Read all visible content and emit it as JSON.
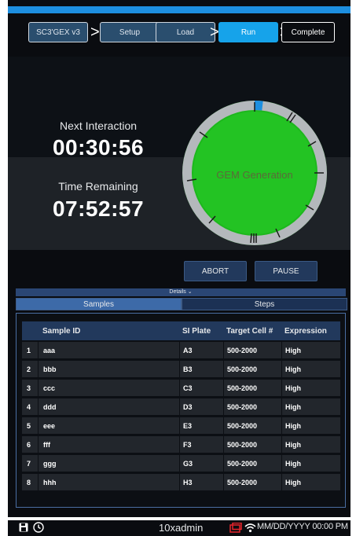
{
  "stepper": {
    "steps": [
      {
        "label": "SC3'GEX v3",
        "state": "done"
      },
      {
        "label": "Setup",
        "state": "done"
      },
      {
        "label": "Load",
        "state": "done"
      },
      {
        "label": "Run",
        "state": "active"
      },
      {
        "label": "Complete",
        "state": "pending"
      }
    ]
  },
  "timers": {
    "next_label": "Next Interaction",
    "next_value": "00:30:56",
    "remaining_label": "Time Remaining",
    "remaining_value": "07:52:57"
  },
  "ring": {
    "label": "GEM Generation",
    "color": "#1db81d",
    "progress_color": "#1d8fe0"
  },
  "controls": {
    "abort_label": "ABORT",
    "pause_label": "PAUSE"
  },
  "details": {
    "label": "Details ⌄"
  },
  "tabs": [
    {
      "label": "Samples",
      "selected": true
    },
    {
      "label": "Steps",
      "selected": false
    }
  ],
  "table": {
    "headers": [
      "Sample ID",
      "SI Plate",
      "Target Cell #",
      "Expression"
    ],
    "rows": [
      {
        "num": "1",
        "id": "aaa",
        "plate": "A3",
        "cells": "500-2000",
        "expr": "High"
      },
      {
        "num": "2",
        "id": "bbb",
        "plate": "B3",
        "cells": "500-2000",
        "expr": "High"
      },
      {
        "num": "3",
        "id": "ccc",
        "plate": "C3",
        "cells": "500-2000",
        "expr": "High"
      },
      {
        "num": "4",
        "id": "ddd",
        "plate": "D3",
        "cells": "500-2000",
        "expr": "High"
      },
      {
        "num": "5",
        "id": "eee",
        "plate": "E3",
        "cells": "500-2000",
        "expr": "High"
      },
      {
        "num": "6",
        "id": "fff",
        "plate": "F3",
        "cells": "500-2000",
        "expr": "High"
      },
      {
        "num": "7",
        "id": "ggg",
        "plate": "G3",
        "cells": "500-2000",
        "expr": "High"
      },
      {
        "num": "8",
        "id": "hhh",
        "plate": "H3",
        "cells": "500-2000",
        "expr": "High"
      }
    ]
  },
  "statusbar": {
    "user": "10xadmin",
    "datetime": "MM/DD/YYYY 00:00 PM",
    "icons": [
      "save-icon",
      "clock-icon",
      "battery-icon",
      "wifi-icon"
    ]
  }
}
